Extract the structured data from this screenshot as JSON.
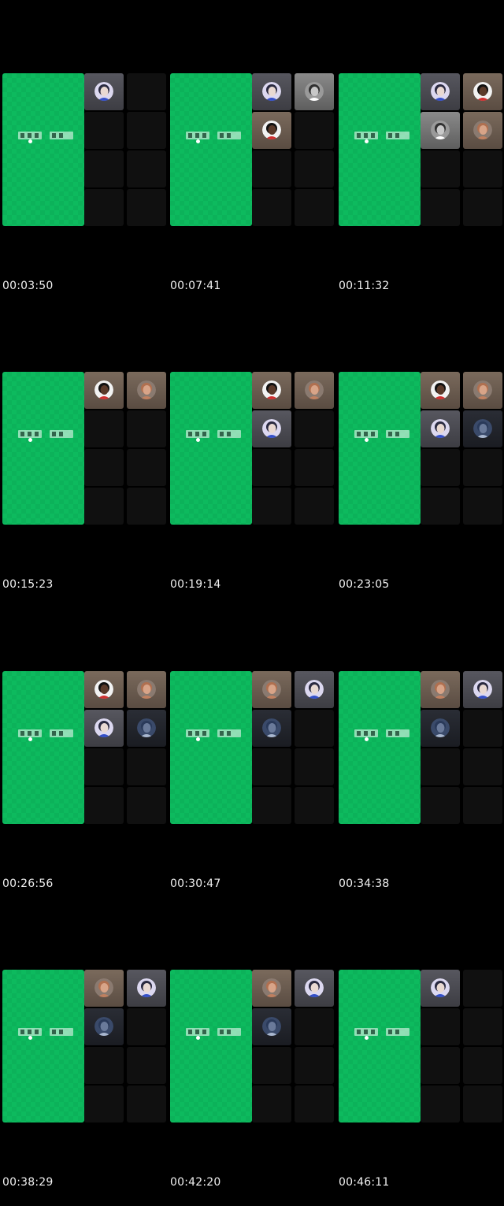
{
  "colors": {
    "stage_green": "#0dba5e",
    "background": "#000000",
    "timestamp_text": "#f0f0f0"
  },
  "frames": [
    {
      "timestamp": "00:03:50",
      "tiles": [
        "person-a",
        null,
        null,
        null,
        null,
        null,
        null,
        null
      ]
    },
    {
      "timestamp": "00:07:41",
      "tiles": [
        "person-a",
        "person-b",
        "person-c",
        null,
        null,
        null,
        null,
        null
      ]
    },
    {
      "timestamp": "00:11:32",
      "tiles": [
        "person-a",
        "person-c",
        "person-b",
        "person-d",
        null,
        null,
        null,
        null
      ]
    },
    {
      "timestamp": "00:15:23",
      "tiles": [
        "person-c",
        "person-d",
        null,
        null,
        null,
        null,
        null,
        null
      ]
    },
    {
      "timestamp": "00:19:14",
      "tiles": [
        "person-c",
        "person-d",
        "person-a",
        null,
        null,
        null,
        null,
        null
      ]
    },
    {
      "timestamp": "00:23:05",
      "tiles": [
        "person-c",
        "person-d",
        "person-a",
        "person-e",
        null,
        null,
        null,
        null
      ]
    },
    {
      "timestamp": "00:26:56",
      "tiles": [
        "person-c",
        "person-d",
        "person-a",
        "person-e",
        null,
        null,
        null,
        null
      ]
    },
    {
      "timestamp": "00:30:47",
      "tiles": [
        "person-d",
        "person-a",
        "person-e",
        null,
        null,
        null,
        null,
        null
      ]
    },
    {
      "timestamp": "00:34:38",
      "tiles": [
        "person-d",
        "person-a",
        "person-e",
        null,
        null,
        null,
        null,
        null
      ]
    },
    {
      "timestamp": "00:38:29",
      "tiles": [
        "person-d",
        "person-a",
        "person-e",
        null,
        null,
        null,
        null,
        null
      ]
    },
    {
      "timestamp": "00:42:20",
      "tiles": [
        "person-d",
        "person-a",
        "person-e",
        null,
        null,
        null,
        null,
        null
      ]
    },
    {
      "timestamp": "00:46:11",
      "tiles": [
        "person-a",
        null,
        null,
        null,
        null,
        null,
        null,
        null
      ]
    }
  ]
}
